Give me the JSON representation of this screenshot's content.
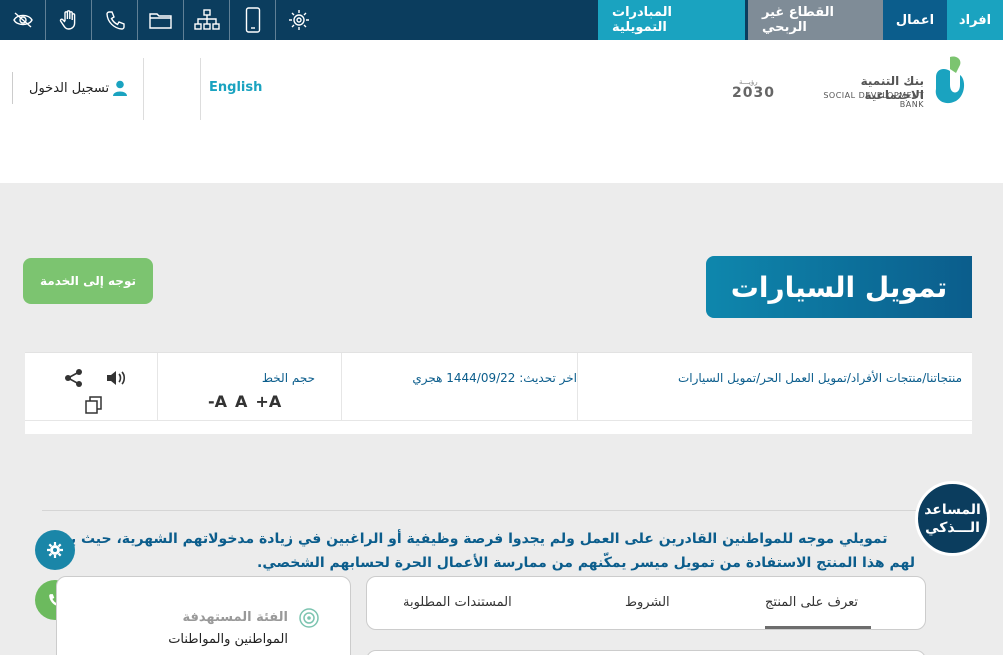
{
  "top_tabs": [
    "افراد",
    "اعمال",
    "القطاع غير الربحي",
    "المبادرات التمويلية"
  ],
  "accessibility_icons": [
    "eye-slash-icon",
    "hand-icon",
    "phone-icon",
    "folder-icon",
    "sitemap-icon",
    "mobile-icon",
    "gear-badge-icon"
  ],
  "header": {
    "login_label": "تسجيل الدخول",
    "language_label": "English",
    "logo_ar": "بنك التنمية الاجتماعية",
    "logo_en": "SOCIAL DEVELOPMENT BANK",
    "vision_top": "رؤيـــة",
    "vision_year": "2030"
  },
  "page": {
    "title": "تمويل السيارات",
    "cta_label": "توجه إلى الخدمة"
  },
  "info": {
    "breadcrumb": "منتجاتنا/منتجات الأفراد/تمويل العمل الحر/تمويل السيارات",
    "updated": "اخر تحديث: 1444/09/22 هجري",
    "font_size_label": "حجم الخط",
    "font_decrease": "-A",
    "font_normal": "A",
    "font_increase": "+A"
  },
  "description": {
    "line1": "تمويلي موجه للمواطنين القادرين على العمل ولم يجدوا فرصة وظيفية أو الراغبين في زيادة مدخولاتهم الشهرية، حيث يت",
    "line2": "لهم هذا المنتج الاستفادة من تمويل ميسر يمكّنهم من ممارسة الأعمال الحرة لحسابهم الشخصي."
  },
  "assistant": {
    "line1": "المساعد",
    "line2": "الـــذكي"
  },
  "tabs": {
    "product": "تعرف على المنتج",
    "terms": "الشروط",
    "documents": "المستندات المطلوبة"
  },
  "target": {
    "title": "الفئة المستهدفة",
    "value": "المواطنين والمواطنات"
  }
}
